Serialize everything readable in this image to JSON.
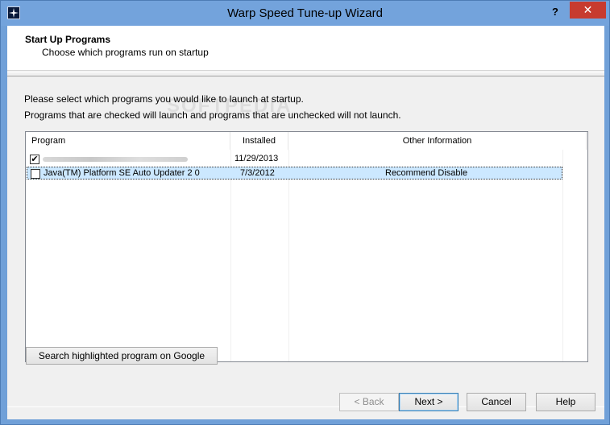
{
  "window": {
    "title": "Warp Speed Tune-up Wizard",
    "help_glyph": "?",
    "close_glyph": "✕"
  },
  "header": {
    "title": "Start Up Programs",
    "subtitle": "Choose which programs run on startup"
  },
  "instructions": {
    "line1": "Please select which programs you would like to launch at startup.",
    "line2": "Programs that are checked will launch and programs that are unchecked will not launch."
  },
  "list": {
    "columns": [
      "Program",
      "Installed",
      "Other Information"
    ],
    "rows": [
      {
        "checked": true,
        "check_glyph": "✔",
        "program": "",
        "installed": "11/29/2013",
        "other": ""
      },
      {
        "checked": false,
        "check_glyph": "",
        "program": "Java(TM) Platform SE Auto Updater 2 0",
        "installed": "7/3/2012",
        "other": "Recommend Disable"
      }
    ]
  },
  "buttons": {
    "google": "Search highlighted program on Google",
    "back": "< Back",
    "next": "Next >",
    "cancel": "Cancel",
    "help": "Help"
  },
  "colors": {
    "titlebar": "#73a3dc",
    "close": "#c73b2f",
    "selection": "#cce8ff"
  }
}
